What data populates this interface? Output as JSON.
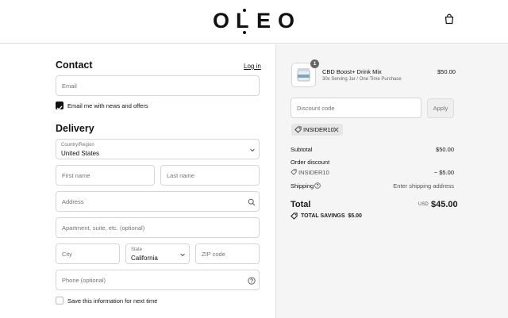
{
  "brand": {
    "logo_text": "OLEO"
  },
  "contact": {
    "heading": "Contact",
    "login_link": "Log in",
    "email_placeholder": "Email",
    "newsletter_label": "Email me with news and offers",
    "newsletter_checked": true
  },
  "delivery": {
    "heading": "Delivery",
    "country_label": "Country/Region",
    "country_value": "United States",
    "first_name_placeholder": "First name",
    "last_name_placeholder": "Last name",
    "address_placeholder": "Address",
    "apartment_placeholder": "Apartment, suite, etc. (optional)",
    "city_placeholder": "City",
    "state_label": "State",
    "state_value": "California",
    "zip_placeholder": "ZIP code",
    "phone_placeholder": "Phone (optional)",
    "save_info_label": "Save this information for next time",
    "save_info_checked": false
  },
  "order": {
    "item": {
      "quantity": "1",
      "title": "CBD Boost+ Drink Mix",
      "subtitle": "30x Serving Jar / One Time Purchase",
      "price": "$50.00"
    },
    "discount_placeholder": "Discount code",
    "apply_label": "Apply",
    "applied_code": "INSIDER10",
    "subtotal_label": "Subtotal",
    "subtotal_value": "$50.00",
    "order_discount_label": "Order discount",
    "discount_code": "INSIDER10",
    "discount_value": "− $5.00",
    "shipping_label": "Shipping",
    "shipping_value": "Enter shipping address",
    "total_label": "Total",
    "currency": "USD",
    "total_value": "$45.00",
    "savings_label": "TOTAL SAVINGS",
    "savings_value": "$5.00"
  },
  "colors": {
    "accent": "#111111",
    "panel_bg": "#f5f5f5",
    "border": "#d6d6d6"
  }
}
